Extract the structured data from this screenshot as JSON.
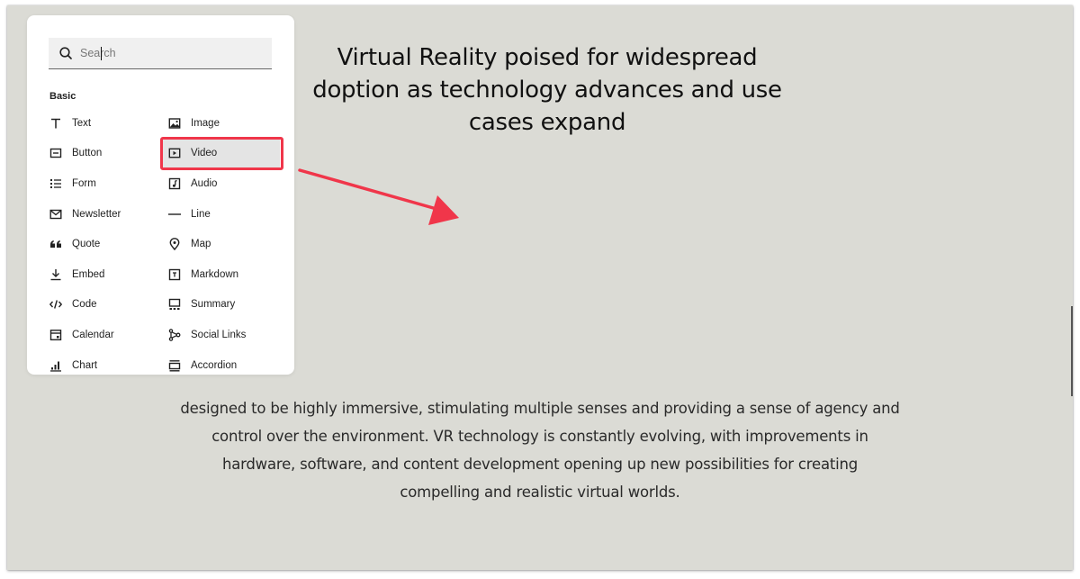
{
  "page": {
    "headline_lines": [
      "Virtual Reality poised for widespread",
      "doption as technology advances and use",
      "cases expand"
    ],
    "body_lines": [
      "designed to be highly immersive, stimulating multiple senses and providing a sense of agency and",
      "control over the environment. VR technology is constantly evolving, with improvements in",
      "hardware, software, and content development opening up new possibilities for creating",
      "compelling and realistic virtual worlds."
    ]
  },
  "panel": {
    "search": {
      "placeholder": "Search",
      "value": "",
      "icon": "search-icon"
    },
    "section_label": "Basic",
    "left_items": [
      {
        "label": "Text",
        "icon": "text-icon"
      },
      {
        "label": "Button",
        "icon": "button-icon"
      },
      {
        "label": "Form",
        "icon": "form-icon"
      },
      {
        "label": "Newsletter",
        "icon": "newsletter-icon"
      },
      {
        "label": "Quote",
        "icon": "quote-icon"
      },
      {
        "label": "Embed",
        "icon": "embed-icon"
      },
      {
        "label": "Code",
        "icon": "code-icon"
      },
      {
        "label": "Calendar",
        "icon": "calendar-icon"
      },
      {
        "label": "Chart",
        "icon": "chart-icon"
      }
    ],
    "right_items": [
      {
        "label": "Image",
        "icon": "image-icon"
      },
      {
        "label": "Video",
        "icon": "video-icon",
        "highlighted": true
      },
      {
        "label": "Audio",
        "icon": "audio-icon"
      },
      {
        "label": "Line",
        "icon": "line-icon"
      },
      {
        "label": "Map",
        "icon": "map-pin-icon"
      },
      {
        "label": "Markdown",
        "icon": "markdown-icon"
      },
      {
        "label": "Summary",
        "icon": "summary-icon"
      },
      {
        "label": "Social Links",
        "icon": "social-links-icon"
      },
      {
        "label": "Accordion",
        "icon": "accordion-icon"
      }
    ]
  },
  "annotation": {
    "color": "#f0364a",
    "target": "Video"
  },
  "colors": {
    "canvas_bg": "#dbdbd5",
    "panel_bg": "#ffffff",
    "hover_bg": "#e4e4e4"
  }
}
